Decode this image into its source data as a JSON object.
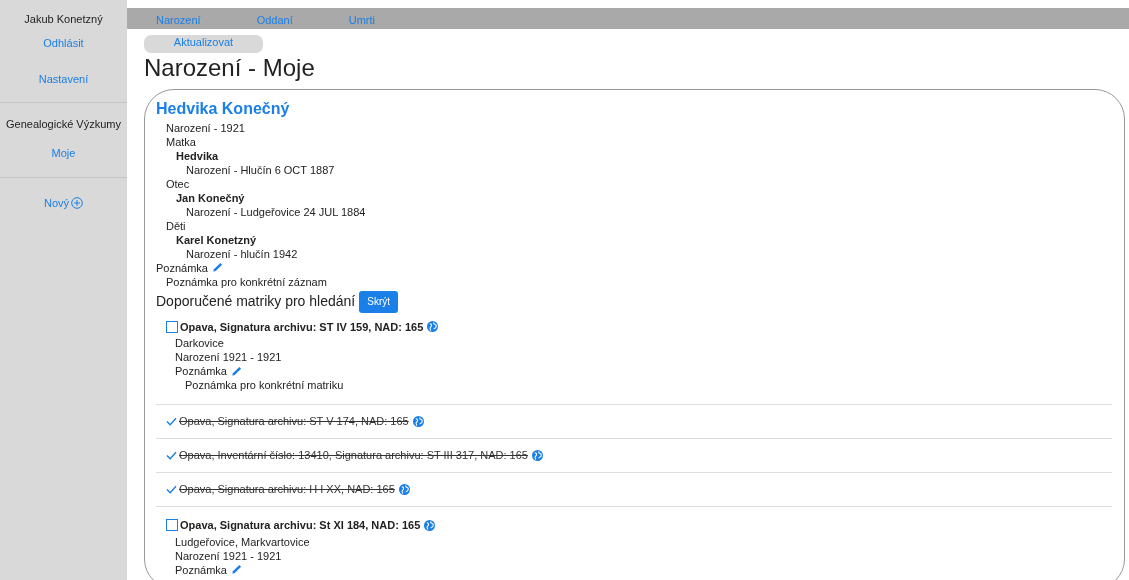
{
  "sidebar": {
    "user": "Jakub Konetzný",
    "links": [
      {
        "label": "Odhlásit"
      },
      {
        "label": "Nastavení"
      }
    ],
    "section": "Genealogické Výzkumy",
    "section_links": [
      {
        "label": "Moje",
        "selected": true
      }
    ],
    "new_label": "Nový"
  },
  "nav": {
    "tabs": [
      {
        "label": "Narození"
      },
      {
        "label": "Oddaní"
      },
      {
        "label": "Umrti"
      }
    ]
  },
  "refresh_button": "Aktualizovat",
  "title": "Narození - Moje",
  "record": {
    "name": "Hedvika Konečný",
    "birth": "Narození - 1921",
    "relations": [
      {
        "label": "Matka",
        "people": [
          {
            "name": "Hedvika",
            "detail": "Narození - Hlučín 6 OCT 1887"
          }
        ]
      },
      {
        "label": "Otec",
        "people": [
          {
            "name": "Jan Konečný",
            "detail": "Narození - Ludgeřovice 24 JUL 1884"
          }
        ]
      },
      {
        "label": "Děti",
        "people": [
          {
            "name": "Karel Konetzný",
            "detail": "Narození - hlučín 1942"
          }
        ]
      }
    ],
    "note_label": "Poznámka",
    "note": "Poznámka pro konkrétní záznam"
  },
  "recommended": {
    "heading": "Doporučené matriky pro hledání",
    "hide_button": "Skrýt",
    "items": [
      {
        "checked": false,
        "title": "Opava, Signatura archivu: ST IV 159, NAD: 165",
        "place": "Darkovice",
        "range": "Narození 1921 - 1921",
        "note_label": "Poznámka",
        "note": "Poznámka pro konkrétní matriku"
      },
      {
        "checked": true,
        "title": "Opava, Signatura archivu: ST V 174, NAD: 165"
      },
      {
        "checked": true,
        "title": "Opava, Inventární číslo: 13410, Signatura archivu: ST III 317, NAD: 165"
      },
      {
        "checked": true,
        "title": "Opava, Signatura archivu: H I XX, NAD: 165"
      },
      {
        "checked": false,
        "title": "Opava, Signatura archivu: St XI 184, NAD: 165",
        "place": "Ludgeřovice, Markvartovice",
        "range": "Narození 1921 - 1921",
        "note_label": "Poznámka"
      }
    ]
  }
}
